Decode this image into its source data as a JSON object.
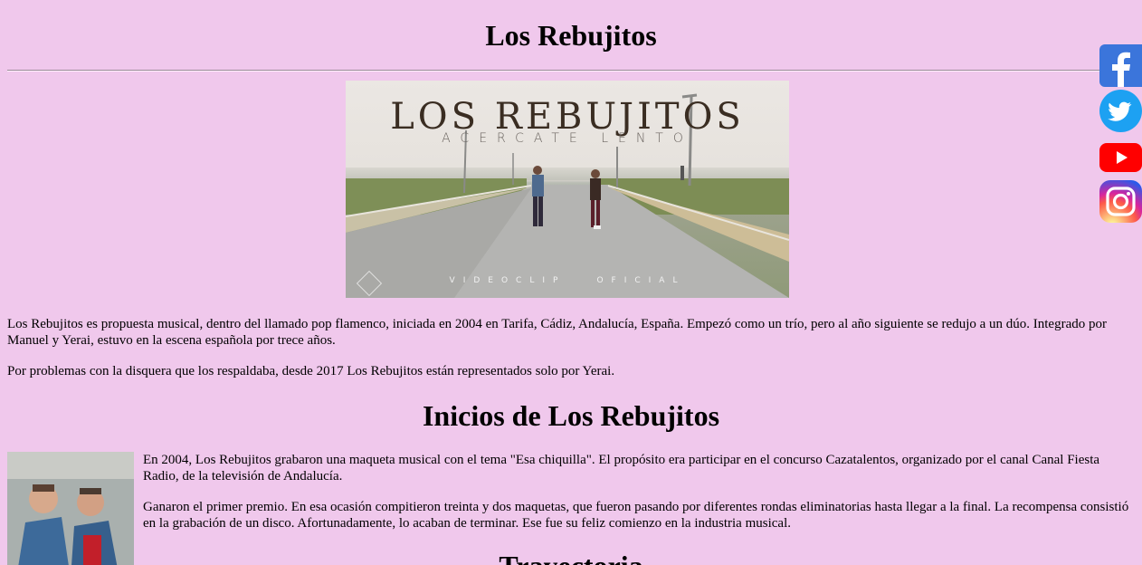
{
  "page": {
    "title": "Los Rebujitos"
  },
  "hero": {
    "brand": "LOS REBUJITOS",
    "song": "ACERCATE LENTO",
    "clip_left": "VIDEOCLIP",
    "clip_right": "OFICIAL"
  },
  "intro": {
    "paragraph_1": "Los Rebujitos es propuesta musical, dentro del llamado pop flamenco, iniciada en 2004 en Tarifa, Cádiz, Andalucía, España. Empezó como un trío, pero al año siguiente se redujo a un dúo. Integrado por Manuel y Yerai, estuvo en la escena española por trece años.",
    "paragraph_2": "Por problemas con la disquera que los respaldaba, desde 2017 Los Rebujitos están representados solo por Yerai."
  },
  "inicios": {
    "heading": "Inicios de Los Rebujitos",
    "paragraph_1": "En 2004, Los Rebujitos grabaron una maqueta musical con el tema \"Esa chiquilla\". El propósito era participar en el concurso Cazatalentos, organizado por el canal Canal Fiesta Radio, de la televisión de Andalucía.",
    "paragraph_2": "Ganaron el primer premio. En esa ocasión compitieron treinta y dos maquetas, que fueron pasando por diferentes rondas eliminatorias hasta llegar a la final. La recompensa consistió en la grabación de un disco. Afortunadamente, lo acaban de terminar. Ese fue su feliz comienzo en la industria musical."
  },
  "trayectoria": {
    "heading": "Trayectoria"
  },
  "social": {
    "facebook_icon": "facebook-icon",
    "twitter_icon": "twitter-icon",
    "youtube_icon": "youtube-icon",
    "instagram_icon": "instagram-icon",
    "colors": {
      "facebook": "#3b75db",
      "twitter": "#1da1f2",
      "youtube": "#ff0000",
      "instagram": "#d6249f"
    }
  },
  "colors": {
    "background": "#f0c8ec"
  }
}
